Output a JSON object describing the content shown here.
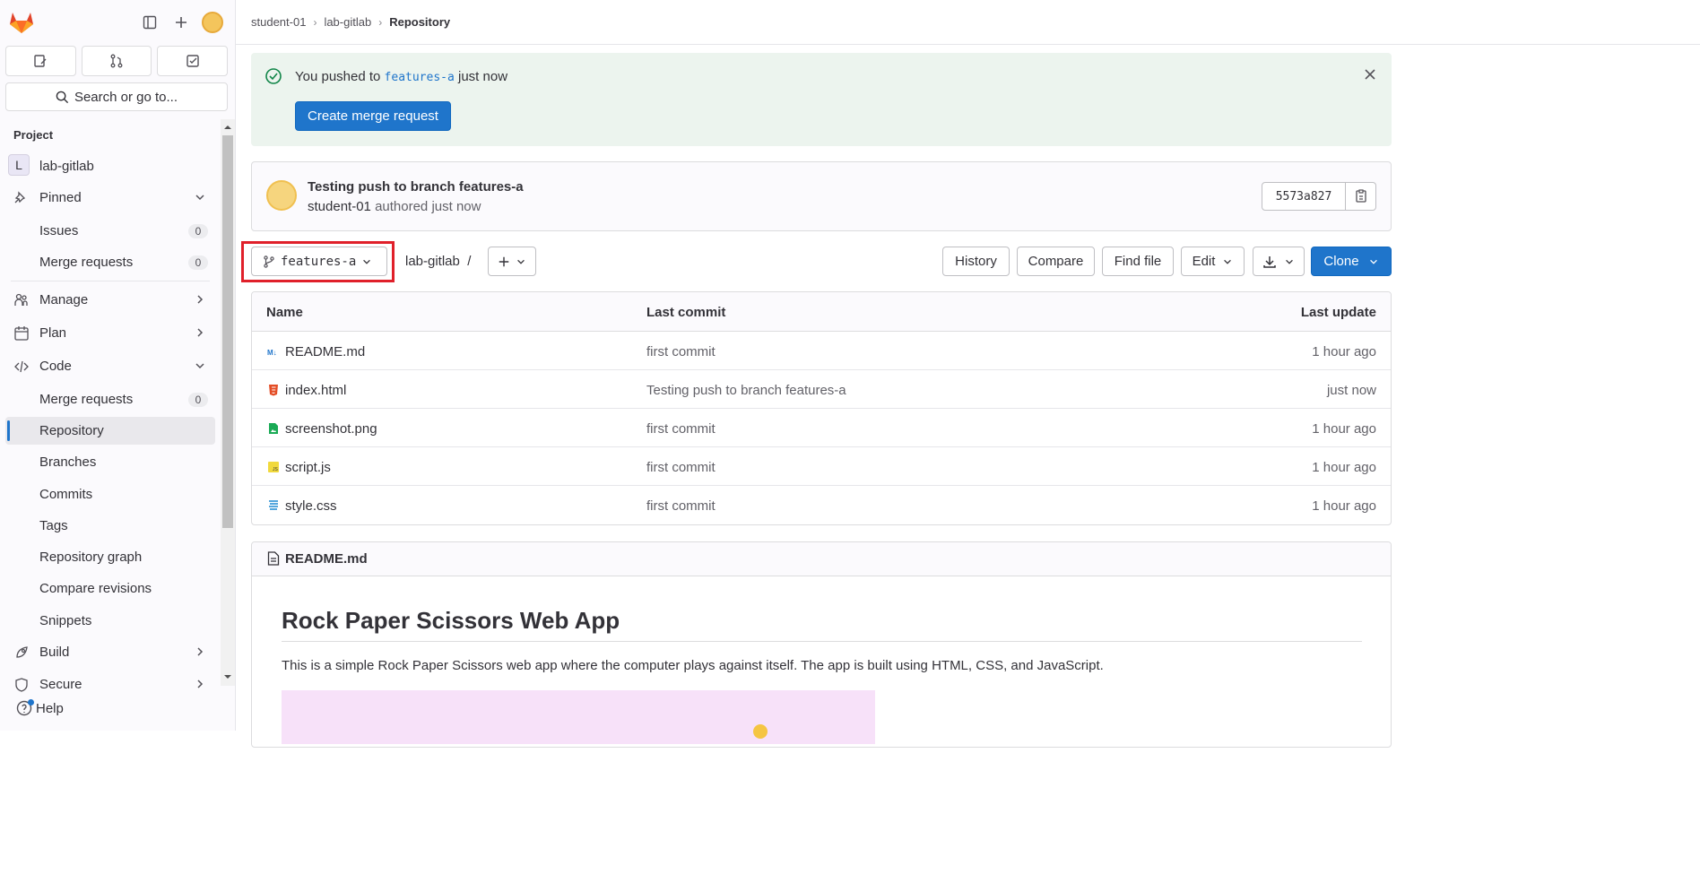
{
  "sidebar": {
    "search_label": "Search or go to...",
    "section_title": "Project",
    "project": {
      "initial": "L",
      "name": "lab-gitlab"
    },
    "pinned": {
      "label": "Pinned",
      "items": [
        {
          "label": "Issues",
          "count": "0"
        },
        {
          "label": "Merge requests",
          "count": "0"
        }
      ]
    },
    "groups": [
      {
        "label": "Manage"
      },
      {
        "label": "Plan"
      },
      {
        "label": "Code"
      }
    ],
    "code_items": [
      {
        "label": "Merge requests",
        "count": "0"
      },
      {
        "label": "Repository"
      },
      {
        "label": "Branches"
      },
      {
        "label": "Commits"
      },
      {
        "label": "Tags"
      },
      {
        "label": "Repository graph"
      },
      {
        "label": "Compare revisions"
      },
      {
        "label": "Snippets"
      }
    ],
    "build": {
      "label": "Build"
    },
    "secure": {
      "label": "Secure"
    },
    "help": "Help"
  },
  "breadcrumb": {
    "items": [
      "student-01",
      "lab-gitlab"
    ],
    "current": "Repository"
  },
  "alert": {
    "prefix": "You pushed to",
    "branch": "features-a",
    "suffix": "just now",
    "button": "Create merge request"
  },
  "commit": {
    "title": "Testing push to branch features-a",
    "author": "student-01",
    "meta": "authored just now",
    "sha": "5573a827"
  },
  "toolbar": {
    "branch": "features-a",
    "path": "lab-gitlab",
    "path_sep": "/",
    "history": "History",
    "compare": "Compare",
    "find_file": "Find file",
    "edit": "Edit",
    "clone": "Clone"
  },
  "table": {
    "headers": {
      "name": "Name",
      "last_commit": "Last commit",
      "last_update": "Last update"
    },
    "rows": [
      {
        "name": "README.md",
        "commit": "first commit",
        "updated": "1 hour ago",
        "icon": "markdown-icon"
      },
      {
        "name": "index.html",
        "commit": "Testing push to branch features-a",
        "updated": "just now",
        "icon": "html-icon"
      },
      {
        "name": "screenshot.png",
        "commit": "first commit",
        "updated": "1 hour ago",
        "icon": "image-icon"
      },
      {
        "name": "script.js",
        "commit": "first commit",
        "updated": "1 hour ago",
        "icon": "js-icon"
      },
      {
        "name": "style.css",
        "commit": "first commit",
        "updated": "1 hour ago",
        "icon": "css-icon"
      }
    ]
  },
  "readme": {
    "filename": "README.md",
    "title": "Rock Paper Scissors Web App",
    "text": "This is a simple Rock Paper Scissors web app where the computer plays against itself. The app is built using HTML, CSS, and JavaScript."
  },
  "colors": {
    "accent": "#1f75cb",
    "alert_bg": "#ecf4ee",
    "highlight": "#e0202a"
  }
}
